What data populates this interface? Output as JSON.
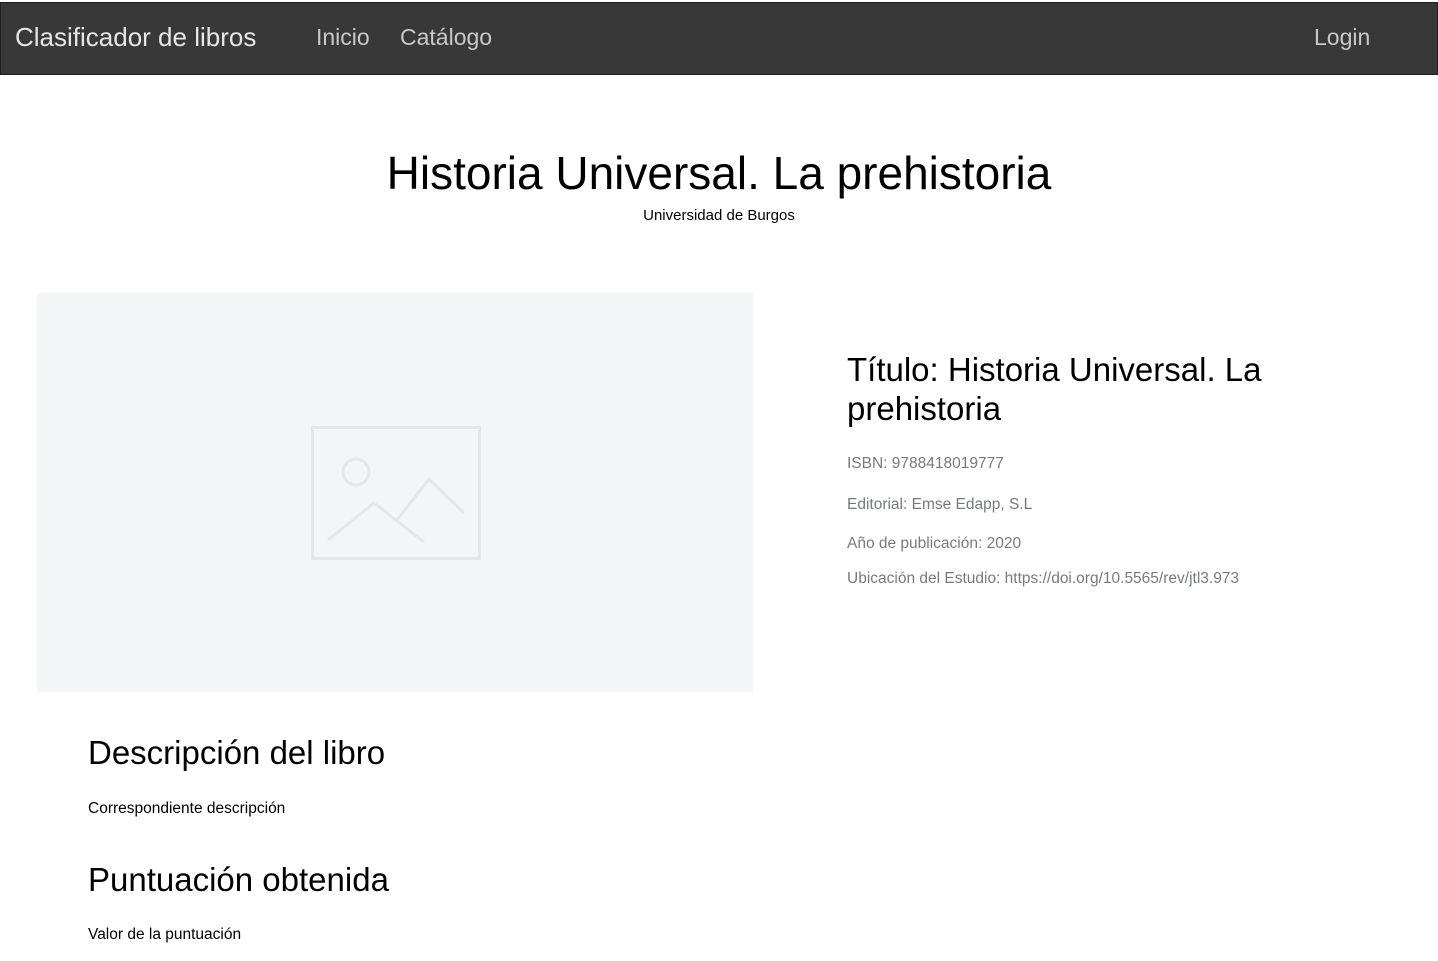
{
  "navbar": {
    "brand": "Clasificador de libros",
    "links": [
      "Inicio",
      "Catálogo"
    ],
    "login": "Login"
  },
  "header": {
    "title": "Historia Universal. La prehistoria",
    "subtitle": "Universidad de Burgos"
  },
  "cover": {
    "icon": "image-placeholder-icon"
  },
  "book": {
    "title": "Título: Historia Universal. La prehistoria",
    "isbn": "ISBN: 9788418019777",
    "editorial": "Editorial: Emse Edapp, S.L",
    "year": "Año de publicación: 2020",
    "location": "Ubicación del Estudio: https://doi.org/10.5565/rev/jtl3.973"
  },
  "description": {
    "heading": "Descripción del libro",
    "text": "Correspondiente descripción"
  },
  "score": {
    "heading": "Puntuación obtenida",
    "text": "Valor de la puntuación"
  },
  "colors": {
    "navbar_bg": "#383838",
    "muted_text": "#777a7d",
    "placeholder_bg": "#f4f5f7"
  }
}
